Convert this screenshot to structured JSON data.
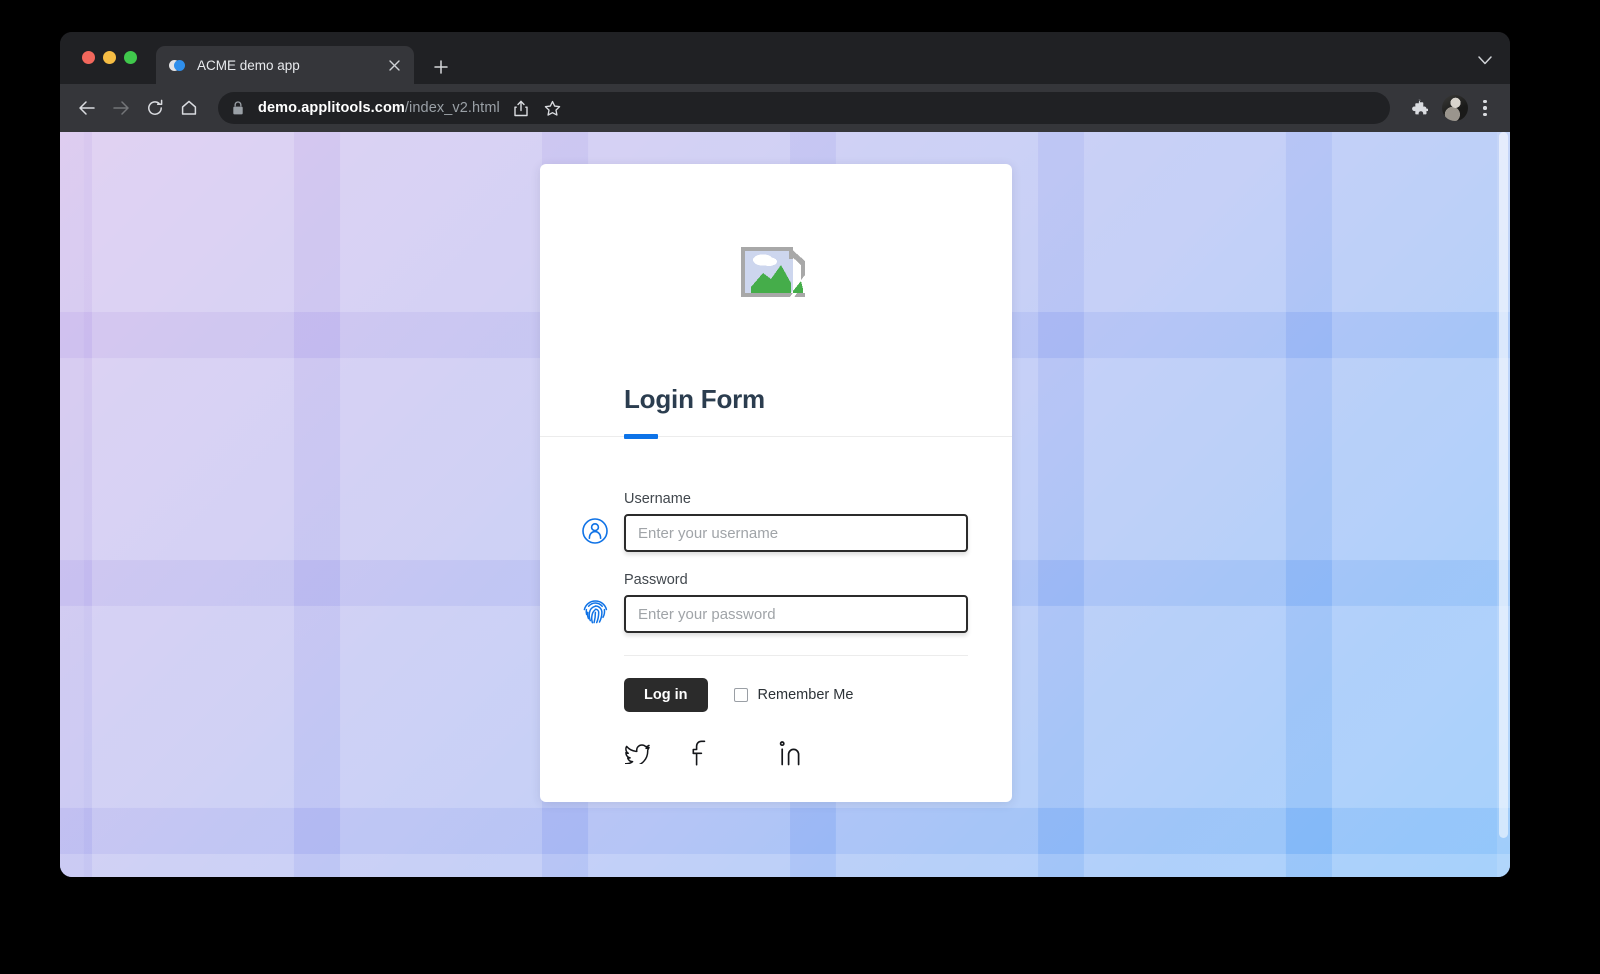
{
  "browser": {
    "tab": {
      "title": "ACME demo app",
      "favicon": "two-circles-icon",
      "close_icon": "close-icon"
    },
    "new_tab_icon": "plus-icon",
    "tabstrip_chevron_icon": "chevron-down-icon",
    "toolbar": {
      "back_icon": "arrow-left-icon",
      "forward_icon": "arrow-right-icon",
      "reload_icon": "reload-icon",
      "home_icon": "home-icon",
      "lock_icon": "lock-icon",
      "url_host": "demo.applitools.com",
      "url_path": "/index_v2.html",
      "share_icon": "share-icon",
      "bookmark_icon": "star-icon",
      "extensions_icon": "puzzle-piece-icon",
      "avatar": "profile-avatar",
      "menu_icon": "three-dots-icon"
    },
    "traffic_lights": {
      "close": "#f2675c",
      "minimize": "#f6bd44",
      "maximize": "#40c84c"
    }
  },
  "page": {
    "background": {
      "gradient_start": "#cdb4ea",
      "gradient_end": "#6bb2f9"
    },
    "scrollbar": "page-scrollbar"
  },
  "card": {
    "logo": "broken-image-icon",
    "title": "Login Form",
    "accent_color": "#0d73e8",
    "fields": [
      {
        "key": "username",
        "label": "Username",
        "placeholder": "Enter your username",
        "value": "",
        "icon": "user-circle-icon"
      },
      {
        "key": "password",
        "label": "Password",
        "placeholder": "Enter your password",
        "value": "",
        "icon": "fingerprint-icon"
      }
    ],
    "login_button_label": "Log in",
    "remember_me_label": "Remember Me",
    "remember_me_checked": false,
    "social": [
      {
        "name": "twitter",
        "icon": "twitter-icon"
      },
      {
        "name": "facebook",
        "icon": "facebook-icon"
      },
      {
        "name": "linkedin",
        "icon": "linkedin-icon"
      }
    ]
  }
}
